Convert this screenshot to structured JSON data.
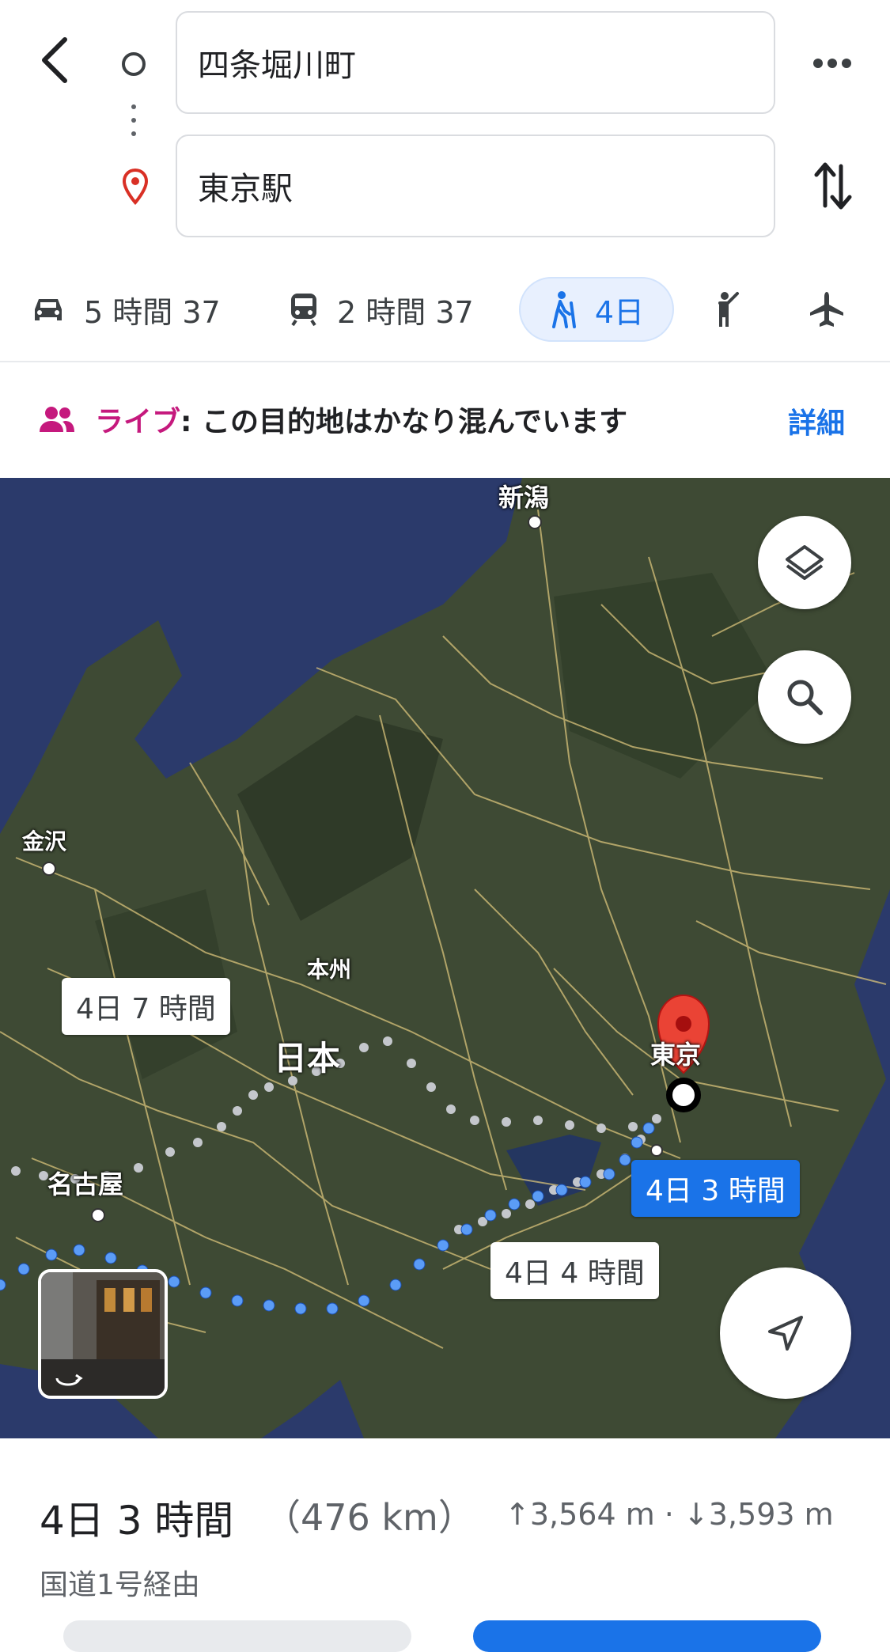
{
  "search": {
    "origin": "四条堀川町",
    "destination": "東京駅"
  },
  "modes": {
    "car": "5 時間 37",
    "transit": "2 時間 37",
    "walk": "4日"
  },
  "live": {
    "tag": "ライブ",
    "message": ": この目的地はかなり混んでいます",
    "detail": "詳細"
  },
  "map": {
    "labels": {
      "niigata": "新潟",
      "kanazawa": "金沢",
      "honshu": "本州",
      "nihon": "日本",
      "nagoya": "名古屋",
      "tokyo": "東京"
    },
    "routes": {
      "alt1": "4日 7 時間",
      "alt2": "4日 4 時間",
      "selected": "4日 3 時間"
    }
  },
  "summary": {
    "time": "4日 3 時間",
    "distance": "（476 km）",
    "elevation": "↑3,564 m · ↓3,593 m",
    "via": "国道1号経由"
  },
  "colors": {
    "accent": "#1a73e8",
    "live": "#c5197d",
    "pin": "#ea4335"
  }
}
